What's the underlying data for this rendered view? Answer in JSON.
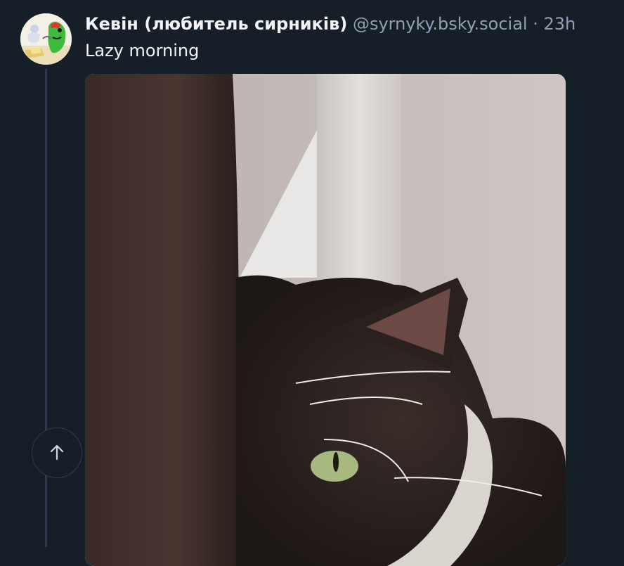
{
  "post": {
    "author_name": "Кевін (любитель сирників)",
    "handle": "@syrnyky.bsky.social",
    "separator": "·",
    "time": "23h",
    "text": "Lazy morning"
  },
  "avatar": {
    "icon": "cartoon-frog-avatar"
  },
  "media": {
    "alt": "photo of a black and white cat peeking from behind a curtain"
  },
  "scroll_top": {
    "icon": "arrow-up-icon"
  },
  "colors": {
    "background": "#161e27",
    "text_primary": "#f1f3f5",
    "text_secondary": "#8fa0b5",
    "thread_line": "#2c3a4b"
  }
}
